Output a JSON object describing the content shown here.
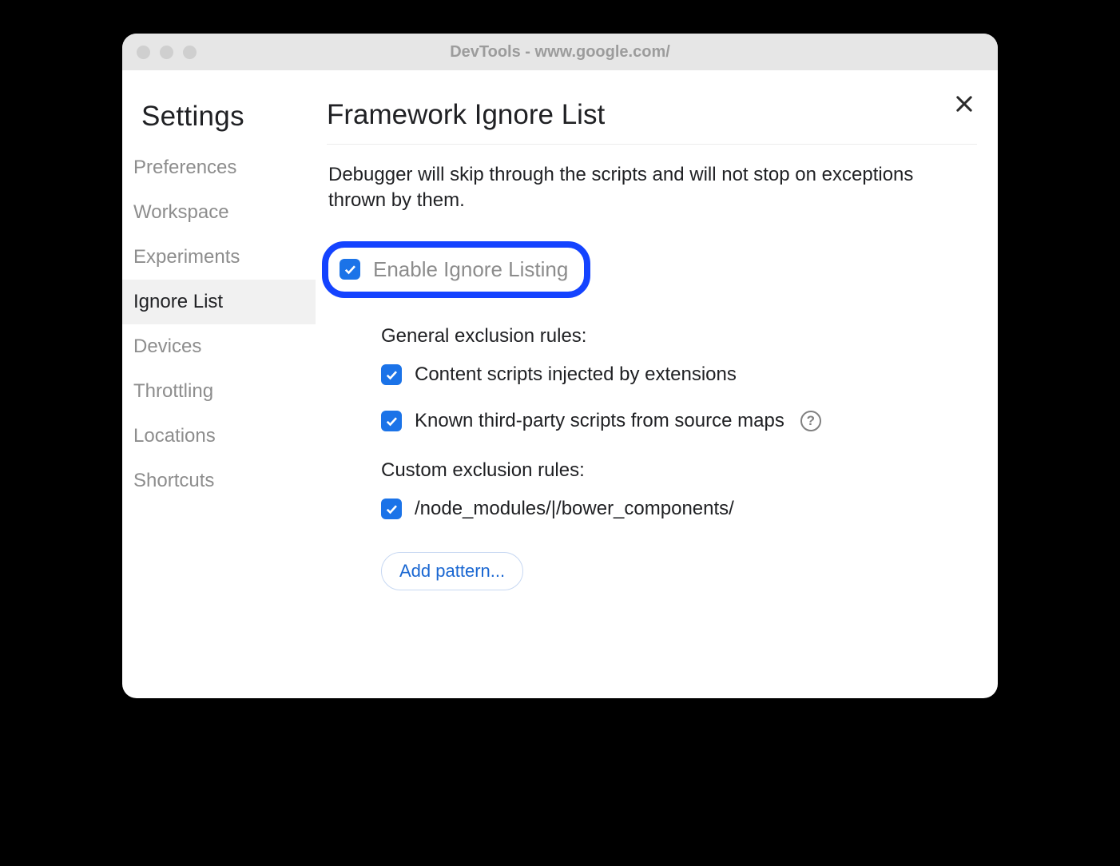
{
  "window": {
    "title": "DevTools - www.google.com/"
  },
  "sidebar": {
    "title": "Settings",
    "items": [
      {
        "label": "Preferences",
        "selected": false
      },
      {
        "label": "Workspace",
        "selected": false
      },
      {
        "label": "Experiments",
        "selected": false
      },
      {
        "label": "Ignore List",
        "selected": true
      },
      {
        "label": "Devices",
        "selected": false
      },
      {
        "label": "Throttling",
        "selected": false
      },
      {
        "label": "Locations",
        "selected": false
      },
      {
        "label": "Shortcuts",
        "selected": false
      }
    ]
  },
  "main": {
    "title": "Framework Ignore List",
    "description": "Debugger will skip through the scripts and will not stop on exceptions thrown by them.",
    "enable_toggle": {
      "label": "Enable Ignore Listing",
      "checked": true
    },
    "general_rules": {
      "heading": "General exclusion rules:",
      "items": [
        {
          "label": "Content scripts injected by extensions",
          "checked": true,
          "help": false
        },
        {
          "label": "Known third-party scripts from source maps",
          "checked": true,
          "help": true
        }
      ]
    },
    "custom_rules": {
      "heading": "Custom exclusion rules:",
      "items": [
        {
          "label": "/node_modules/|/bower_components/",
          "checked": true
        }
      ]
    },
    "add_button": "Add pattern..."
  }
}
